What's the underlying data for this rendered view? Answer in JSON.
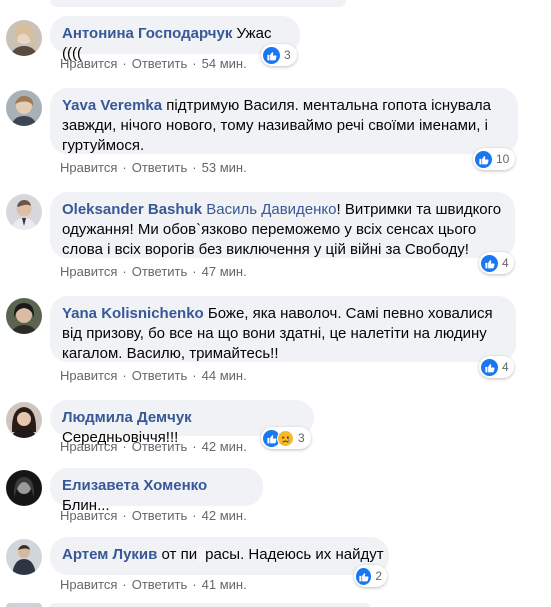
{
  "comments": [
    {
      "author": "Антонина Господарчук",
      "text": "Ужас ((((",
      "like": "Нравится",
      "reply": "Ответить",
      "time": "54 мин.",
      "reactions": "3",
      "avatar_color": "#7a6c63"
    },
    {
      "author": "Yava Veremka",
      "text": "підтримую Василя. ментальна гопота існувала завжди, нічого нового, тому називаймо речі своїми іменами, і гуртуймося.",
      "like": "Нравится",
      "reply": "Ответить",
      "time": "53 мин.",
      "reactions": "10",
      "avatar_color": "#8a8f96"
    },
    {
      "author": "Oleksander Bashuk",
      "mention": "Василь Давиденко",
      "text": "! Витримки та швидкого одужання! Ми обов`язково переможемо у всіх сенсах цього слова і всіх ворогів без виключення у цій війні за Свободу!",
      "like": "Нравится",
      "reply": "Ответить",
      "time": "47 мин.",
      "reactions": "4",
      "avatar_color": "#b9b9bd"
    },
    {
      "author": "Yana Kolisnichenko",
      "text": "Боже, яка наволоч. Самі певно ховалися від призову, бо все на що вони здатні, це налетіти на людину кагалом. Василю, тримайтесь!!",
      "like": "Нравится",
      "reply": "Ответить",
      "time": "44 мин.",
      "reactions": "4",
      "avatar_color": "#4a4f45"
    },
    {
      "author": "Людмила Демчук",
      "text": "Середньовіччя!!!",
      "like": "Нравится",
      "reply": "Ответить",
      "time": "42 мин.",
      "reactions": "3",
      "avatar_color": "#3b2d28"
    },
    {
      "author": "Елизавета Хоменко",
      "text": "Блин...",
      "like": "Нравится",
      "reply": "Ответить",
      "time": "42 мин.",
      "avatar_color": "#2b2b2b"
    },
    {
      "author": "Артем Лукив",
      "text": "от пи",
      "text_after_cover": "расы. Надеюсь их найдут",
      "like": "Нравится",
      "reply": "Ответить",
      "time": "41 мин.",
      "reactions": "2",
      "avatar_color": "#9a9ea6"
    }
  ],
  "colors": {
    "author": "#385898",
    "bubble": "#f0f2f5",
    "meta": "#65676b",
    "like": "#1877f2",
    "sad": "#f7b928"
  }
}
